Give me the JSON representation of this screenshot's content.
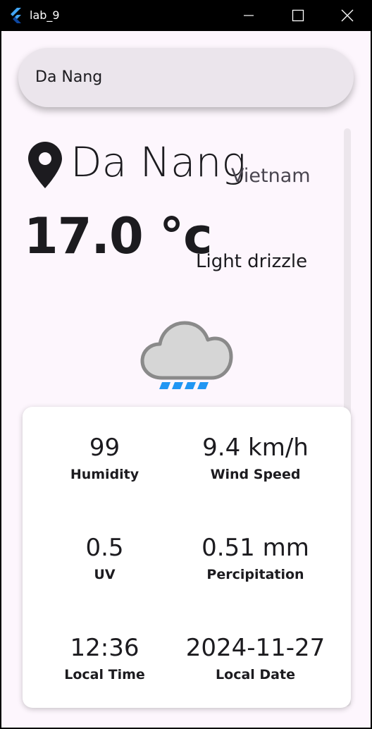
{
  "window": {
    "title": "lab_9"
  },
  "search": {
    "value": "Da Nang"
  },
  "location": {
    "city": "Da Nang",
    "country": "Vietnam"
  },
  "current": {
    "temperature": "17.0 °c",
    "condition": "Light drizzle",
    "icon": "cloud-rain-icon"
  },
  "stats": [
    {
      "value": "99",
      "label": "Humidity"
    },
    {
      "value": "9.4 km/h",
      "label": "Wind Speed"
    },
    {
      "value": "0.5",
      "label": "UV"
    },
    {
      "value": "0.51 mm",
      "label": "Percipitation"
    },
    {
      "value": "12:36",
      "label": "Local Time"
    },
    {
      "value": "2024-11-27",
      "label": "Local Date"
    }
  ],
  "colors": {
    "background": "#fdf6fd",
    "search_pill": "#ebe5ec",
    "text": "#1c1b1f",
    "rain_drops": "#2196f3",
    "cloud": "#d6d6d6",
    "cloud_outline": "#8a8a8a"
  }
}
